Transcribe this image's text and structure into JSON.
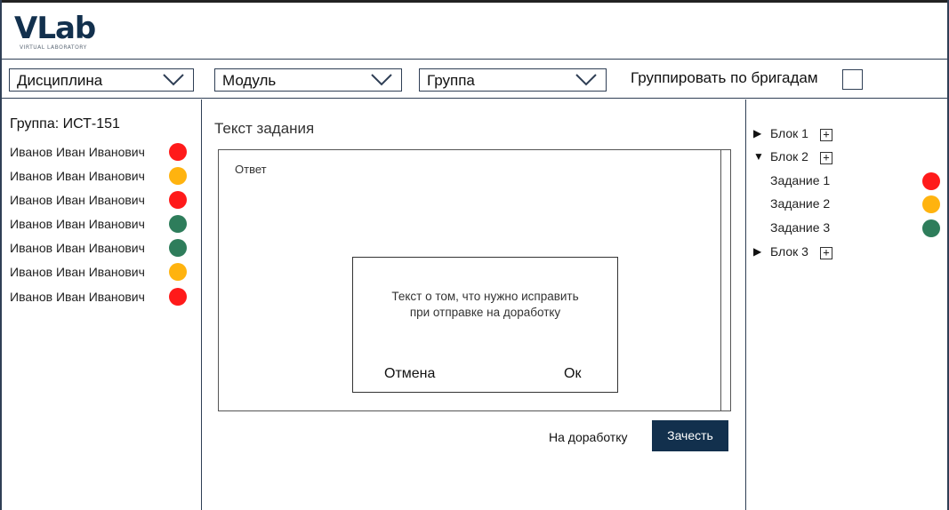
{
  "header": {
    "logo_main": "VLab",
    "logo_sub": "VIRTUAL LABORATORY"
  },
  "filters": {
    "discipline": "Дисциплина",
    "module": "Модуль",
    "group": "Группа",
    "group_by_brigades": "Группировать по бригадам",
    "group_by_checked": false
  },
  "left": {
    "group_title": "Группа: ИСТ-151",
    "students": [
      {
        "name": "Иванов Иван Иванович",
        "status": "red"
      },
      {
        "name": "Иванов Иван Иванович",
        "status": "yellow"
      },
      {
        "name": "Иванов Иван Иванович",
        "status": "red"
      },
      {
        "name": "Иванов Иван Иванович",
        "status": "green"
      },
      {
        "name": "Иванов Иван Иванович",
        "status": "green"
      },
      {
        "name": "Иванов Иван Иванович",
        "status": "yellow"
      },
      {
        "name": "Иванов Иван Иванович",
        "status": "red"
      }
    ]
  },
  "center": {
    "task_title": "Текст задания",
    "answer_label": "Ответ",
    "dialog": {
      "text_line1": "Текст о том, что нужно исправить",
      "text_line2": "при отправке на доработку",
      "cancel_label": "Отмена",
      "ok_label": "Ок"
    },
    "revise_label": "На доработку",
    "accept_label": "Зачесть"
  },
  "tree": {
    "blocks": [
      {
        "label": "Блок 1",
        "expanded": false,
        "arrow": "▶"
      },
      {
        "label": "Блок 2",
        "expanded": true,
        "arrow": "▼",
        "tasks": [
          {
            "label": "Задание 1",
            "status": "red"
          },
          {
            "label": "Задание 2",
            "status": "yellow"
          },
          {
            "label": "Задание 3",
            "status": "green"
          }
        ]
      },
      {
        "label": "Блок 3",
        "expanded": false,
        "arrow": "▶"
      }
    ],
    "plus_symbol": "+"
  },
  "colors": {
    "red": "#ff1a1a",
    "yellow": "#ffb30f",
    "green": "#2e7d5b",
    "brand": "#12304d",
    "border": "#2f3f55"
  }
}
